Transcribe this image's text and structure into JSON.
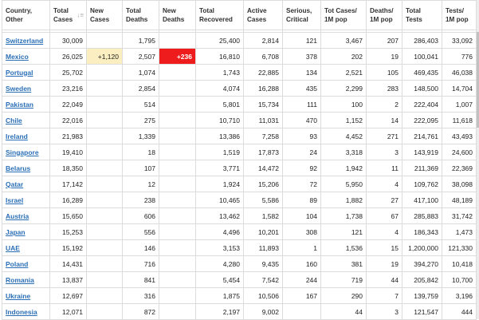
{
  "headers": [
    "Country,\nOther",
    "Total\nCases",
    "New\nCases",
    "Total\nDeaths",
    "New\nDeaths",
    "Total\nRecovered",
    "Active\nCases",
    "Serious,\nCritical",
    "Tot Cases/\n1M pop",
    "Deaths/\n1M pop",
    "Total\nTests",
    "Tests/\n1M pop"
  ],
  "rows": [
    [
      "Switzerland",
      "30,009",
      "",
      "1,795",
      "",
      "25,400",
      "2,814",
      "121",
      "3,467",
      "207",
      "286,403",
      "33,092"
    ],
    [
      "Mexico",
      "26,025",
      "+1,120",
      "2,507",
      "+236",
      "16,810",
      "6,708",
      "378",
      "202",
      "19",
      "100,041",
      "776"
    ],
    [
      "Portugal",
      "25,702",
      "",
      "1,074",
      "",
      "1,743",
      "22,885",
      "134",
      "2,521",
      "105",
      "469,435",
      "46,038"
    ],
    [
      "Sweden",
      "23,216",
      "",
      "2,854",
      "",
      "4,074",
      "16,288",
      "435",
      "2,299",
      "283",
      "148,500",
      "14,704"
    ],
    [
      "Pakistan",
      "22,049",
      "",
      "514",
      "",
      "5,801",
      "15,734",
      "111",
      "100",
      "2",
      "222,404",
      "1,007"
    ],
    [
      "Chile",
      "22,016",
      "",
      "275",
      "",
      "10,710",
      "11,031",
      "470",
      "1,152",
      "14",
      "222,095",
      "11,618"
    ],
    [
      "Ireland",
      "21,983",
      "",
      "1,339",
      "",
      "13,386",
      "7,258",
      "93",
      "4,452",
      "271",
      "214,761",
      "43,493"
    ],
    [
      "Singapore",
      "19,410",
      "",
      "18",
      "",
      "1,519",
      "17,873",
      "24",
      "3,318",
      "3",
      "143,919",
      "24,600"
    ],
    [
      "Belarus",
      "18,350",
      "",
      "107",
      "",
      "3,771",
      "14,472",
      "92",
      "1,942",
      "11",
      "211,369",
      "22,369"
    ],
    [
      "Qatar",
      "17,142",
      "",
      "12",
      "",
      "1,924",
      "15,206",
      "72",
      "5,950",
      "4",
      "109,762",
      "38,098"
    ],
    [
      "Israel",
      "16,289",
      "",
      "238",
      "",
      "10,465",
      "5,586",
      "89",
      "1,882",
      "27",
      "417,100",
      "48,189"
    ],
    [
      "Austria",
      "15,650",
      "",
      "606",
      "",
      "13,462",
      "1,582",
      "104",
      "1,738",
      "67",
      "285,883",
      "31,742"
    ],
    [
      "Japan",
      "15,253",
      "",
      "556",
      "",
      "4,496",
      "10,201",
      "308",
      "121",
      "4",
      "186,343",
      "1,473"
    ],
    [
      "UAE",
      "15,192",
      "",
      "146",
      "",
      "3,153",
      "11,893",
      "1",
      "1,536",
      "15",
      "1,200,000",
      "121,330"
    ],
    [
      "Poland",
      "14,431",
      "",
      "716",
      "",
      "4,280",
      "9,435",
      "160",
      "381",
      "19",
      "394,270",
      "10,418"
    ],
    [
      "Romania",
      "13,837",
      "",
      "841",
      "",
      "5,454",
      "7,542",
      "244",
      "719",
      "44",
      "205,842",
      "10,700"
    ],
    [
      "Ukraine",
      "12,697",
      "",
      "316",
      "",
      "1,875",
      "10,506",
      "167",
      "290",
      "7",
      "139,759",
      "3,196"
    ],
    [
      "Indonesia",
      "12,071",
      "",
      "872",
      "",
      "2,197",
      "9,002",
      "",
      "44",
      "3",
      "121,547",
      "444"
    ]
  ],
  "highlights": {
    "new_cases_bg": "#fbeec0",
    "new_deaths_bg": "#ee1c1c",
    "link_color": "#2a6fb7"
  }
}
